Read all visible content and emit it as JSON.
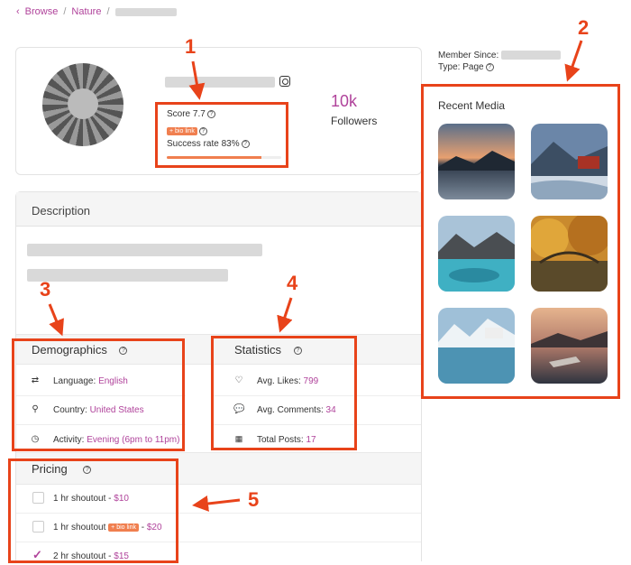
{
  "breadcrumb": {
    "browse": "Browse",
    "sep1": "/",
    "nature": "Nature",
    "sep2": "/"
  },
  "profile": {
    "score_label": "Score 7.7",
    "bio_badge": "+ bio link",
    "success_label": "Success rate 83%",
    "success_rate": 0.83,
    "followers_count": "10k",
    "followers_label": "Followers"
  },
  "meta": {
    "member_since_label": "Member Since:",
    "type_label": "Type: Page"
  },
  "description": {
    "title": "Description"
  },
  "demographics": {
    "title": "Demographics",
    "rows": [
      {
        "icon": "language-icon",
        "label": "Language: ",
        "value": "English"
      },
      {
        "icon": "location-pin-icon",
        "label": "Country: ",
        "value": "United States"
      },
      {
        "icon": "clock-icon",
        "label": "Activity: ",
        "value": "Evening (6pm to 11pm)"
      }
    ]
  },
  "statistics": {
    "title": "Statistics",
    "rows": [
      {
        "icon": "heart-icon",
        "label": "Avg. Likes: ",
        "value": "799"
      },
      {
        "icon": "comment-icon",
        "label": "Avg. Comments: ",
        "value": "34"
      },
      {
        "icon": "grid-icon",
        "label": "Total Posts: ",
        "value": "17"
      }
    ]
  },
  "pricing": {
    "title": "Pricing",
    "rows": [
      {
        "label": "1 hr shoutout",
        "badge": "",
        "dash": " - ",
        "price": "$10",
        "checked": false
      },
      {
        "label": "1 hr shoutout",
        "badge": "+ bio link",
        "dash": " - ",
        "price": "$20",
        "checked": false
      },
      {
        "label": "2 hr shoutout",
        "badge": "",
        "dash": " - ",
        "price": "$15",
        "checked": true
      }
    ]
  },
  "recent_media": {
    "title": "Recent Media"
  },
  "annotations": [
    "1",
    "2",
    "3",
    "4",
    "5"
  ],
  "colors": {
    "accent": "#b0439b",
    "annotation": "#e8431a",
    "badge": "#f07f4f"
  }
}
